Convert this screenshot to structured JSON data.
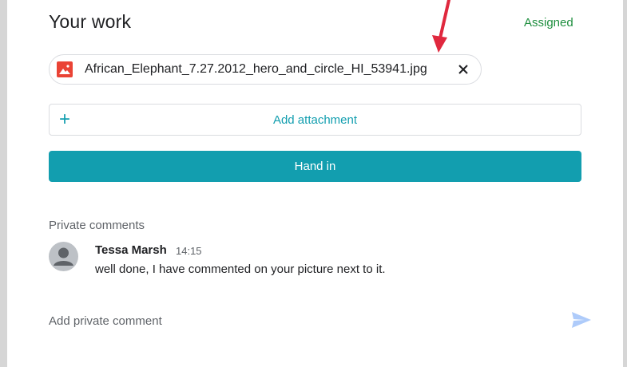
{
  "work": {
    "title": "Your work",
    "status": "Assigned",
    "status_color": "#1e8e3e"
  },
  "attachment": {
    "file_name": "African_Elephant_7.27.2012_hero_and_circle_HI_53941.jpg",
    "file_icon": "image-file-icon",
    "remove_icon": "close-icon"
  },
  "actions": {
    "add_attachment_label": "Add attachment",
    "add_icon": "plus-icon",
    "hand_in_label": "Hand in",
    "accent_color": "#129eaf"
  },
  "comments": {
    "section_label": "Private comments",
    "items": [
      {
        "author": "Tessa Marsh",
        "time": "14:15",
        "text": "well done, I have commented on your picture next to it."
      }
    ],
    "input_placeholder": "Add private comment",
    "send_icon": "send-icon"
  },
  "annotation": {
    "arrow_icon": "red-arrow-icon",
    "arrow_color": "#e0283e"
  }
}
